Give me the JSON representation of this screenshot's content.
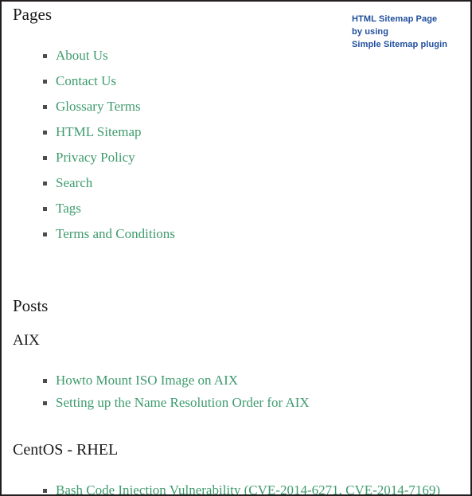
{
  "annotation": {
    "lines": [
      "HTML Sitemap Page",
      "by using",
      "Simple Sitemap plugin"
    ],
    "color": "#1f4e9c"
  },
  "theme": {
    "link_color": "#3f9b6d",
    "heading_color": "#1a1a1a",
    "bullet_color": "#4d4d4d",
    "border_color": "#231f20",
    "background": "#ffffff"
  },
  "sections": [
    {
      "heading": "Pages",
      "items": [
        {
          "label": "About Us"
        },
        {
          "label": "Contact Us"
        },
        {
          "label": "Glossary Terms"
        },
        {
          "label": "HTML Sitemap"
        },
        {
          "label": "Privacy Policy"
        },
        {
          "label": "Search"
        },
        {
          "label": "Tags"
        },
        {
          "label": "Terms and Conditions"
        }
      ]
    },
    {
      "heading": "Posts",
      "items": []
    },
    {
      "heading": "AIX",
      "items": [
        {
          "label": "Howto Mount ISO Image on AIX"
        },
        {
          "label": "Setting up the Name Resolution Order for AIX"
        }
      ]
    },
    {
      "heading": "CentOS - RHEL",
      "items": [
        {
          "label": "Bash Code Injection Vulnerability (CVE-2014-6271, CVE-2014-7169)"
        }
      ]
    }
  ]
}
